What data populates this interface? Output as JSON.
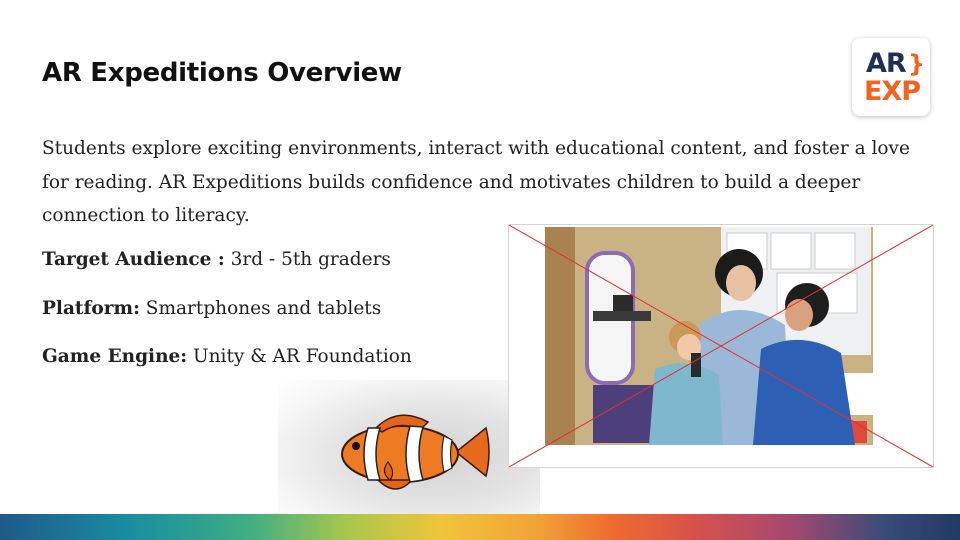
{
  "slide": {
    "title": "AR Expeditions Overview",
    "description": "Students explore exciting environments, interact with educational content, and foster a love for reading. AR Expeditions builds confidence and motivates children to build a deeper connection to literacy.",
    "specs": [
      {
        "label": "Target Audience :",
        "value": " 3rd -  5th graders"
      },
      {
        "label": "Platform:",
        "value": " Smartphones and tablets"
      },
      {
        "label": "Game Engine:",
        "value": " Unity & AR Foundation"
      }
    ]
  },
  "logo": {
    "line1": "AR",
    "bracket": "}",
    "line2": "EXP",
    "colors": {
      "navy": "#1f2e55",
      "orange": "#f06422"
    }
  },
  "images": {
    "fish": "clownfish-3d-model",
    "photo": "classroom-photo-teacher-and-students-with-ar-devices",
    "photo_overlay": "red-x-crossed-out"
  },
  "colors": {
    "title": "#111111",
    "body": "#222222",
    "cross": "#e03030"
  }
}
